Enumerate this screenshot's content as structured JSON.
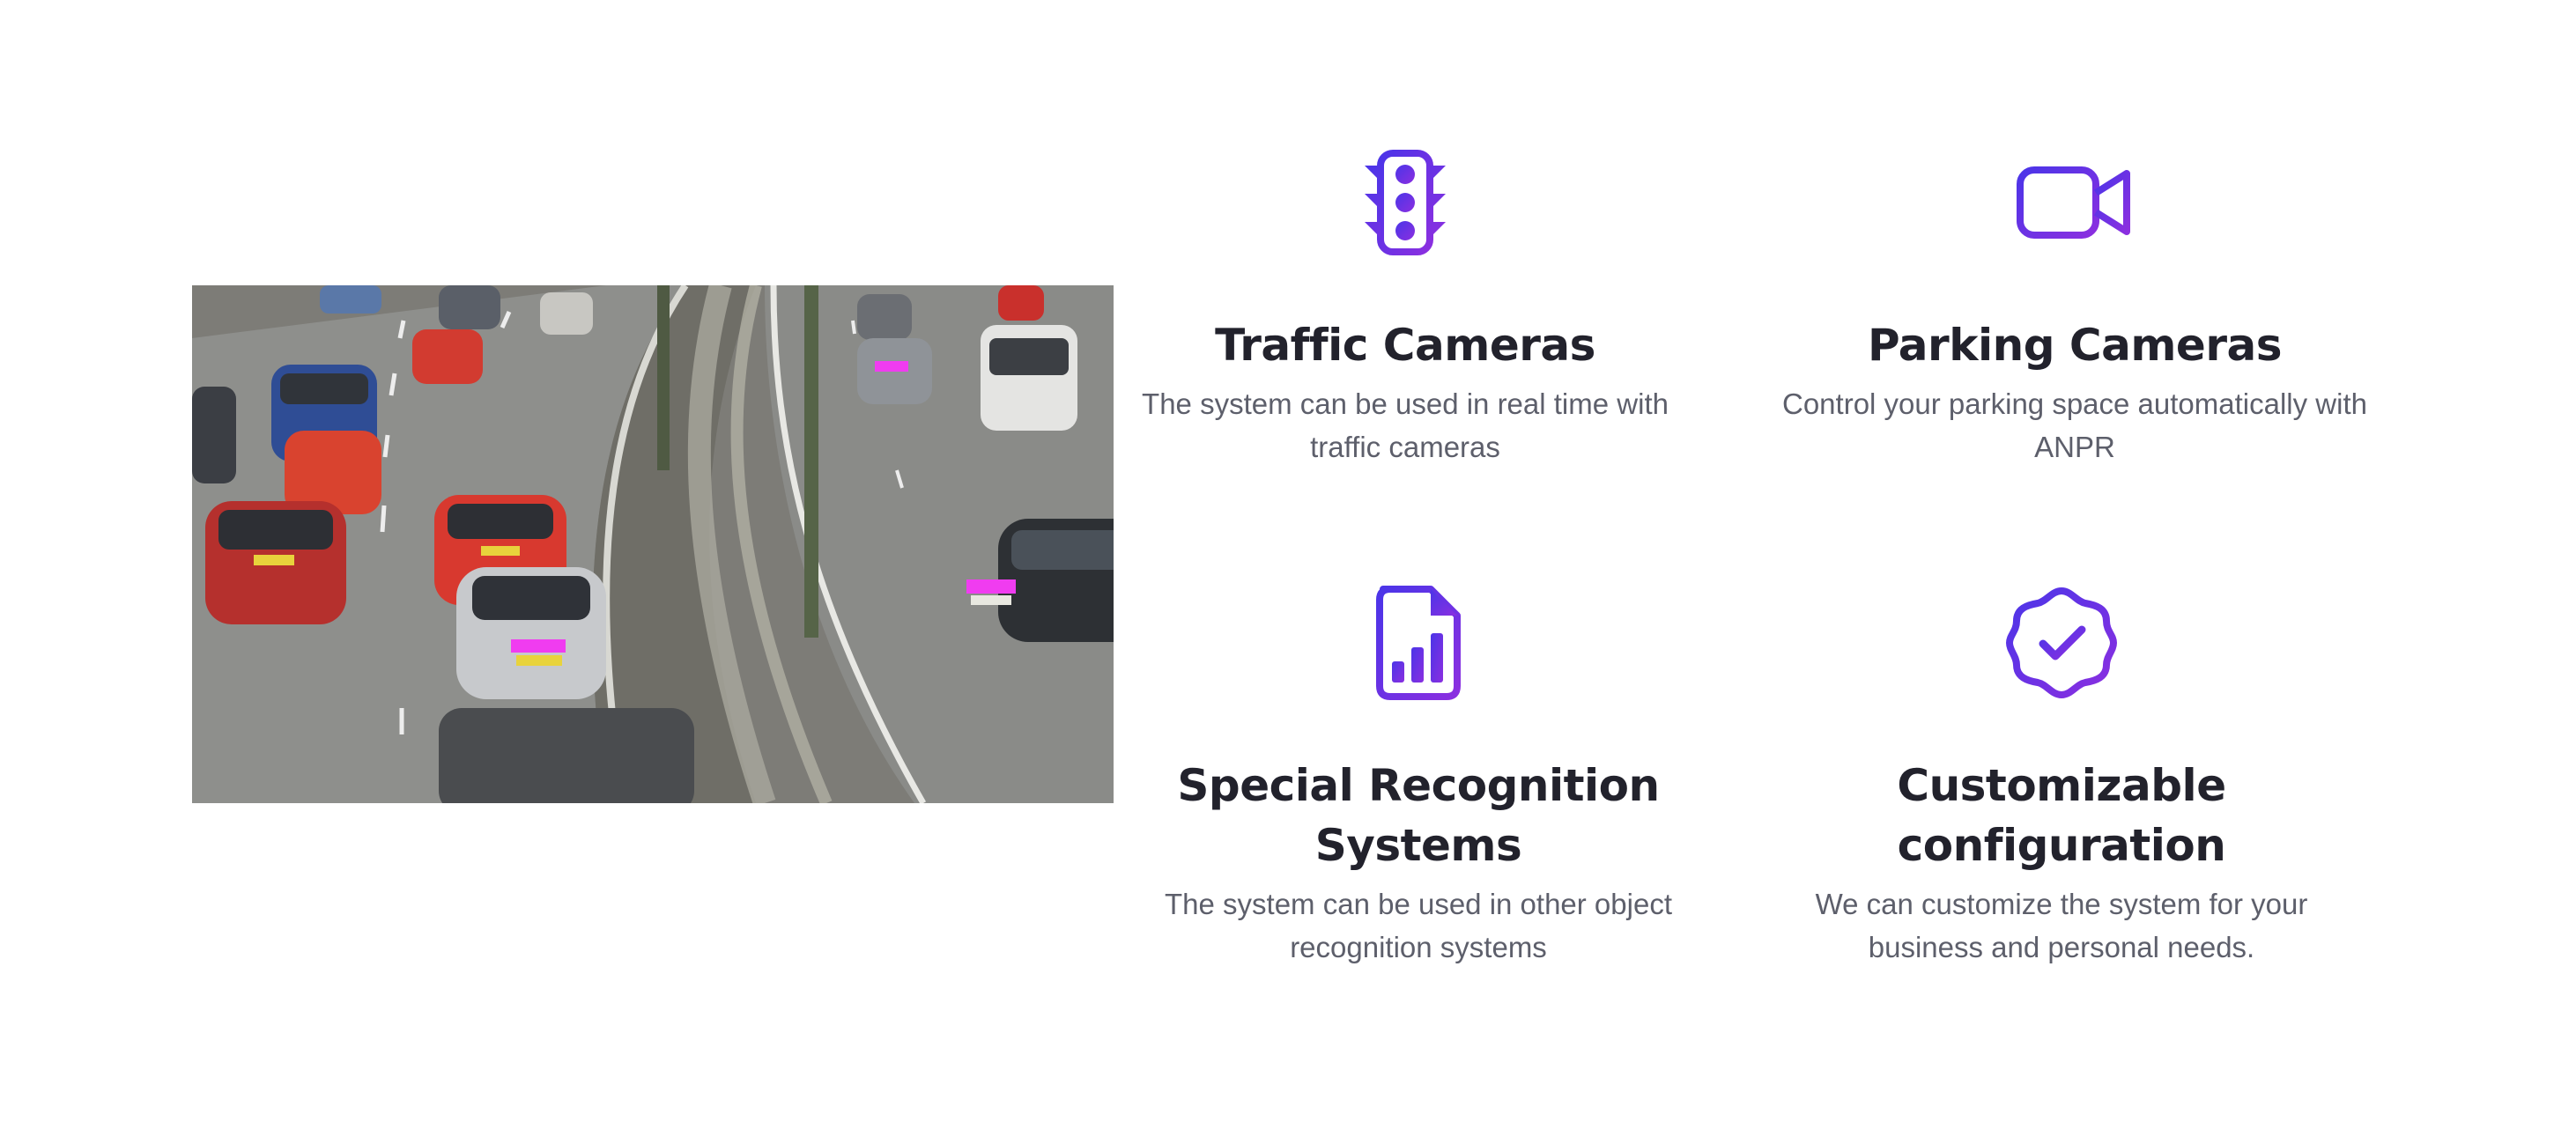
{
  "features": [
    {
      "icon": "traffic-light-icon",
      "title": "Traffic Cameras",
      "description": "The system can be used in real time with traffic cameras"
    },
    {
      "icon": "video-camera-icon",
      "title": "Parking Cameras",
      "description": "Control your parking space automatically with ANPR"
    },
    {
      "icon": "chart-file-icon",
      "title": "Special Recognition Systems",
      "description": "The system can be used in other object recognition systems"
    },
    {
      "icon": "verified-badge-icon",
      "title": "Customizable configuration",
      "description": "We can customize the system for your business and personal needs."
    }
  ],
  "colors": {
    "accent_start": "#7b2fe3",
    "accent_end": "#4a34e6",
    "heading": "#22222c",
    "body_text": "#5d5f6b",
    "plate_highlight": "#f03cf0"
  }
}
